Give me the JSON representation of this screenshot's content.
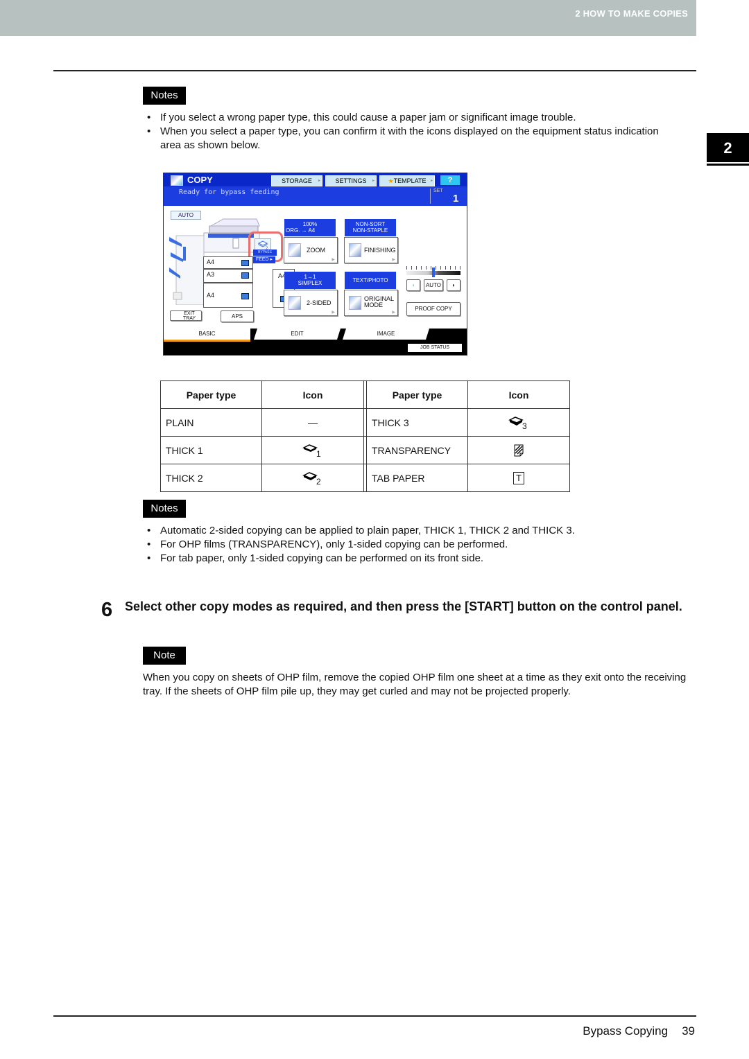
{
  "header": {
    "chapter_title": "2 HOW TO MAKE COPIES",
    "chapter_tab": "2"
  },
  "notes1": {
    "label": "Notes",
    "items": [
      "If you select a wrong paper type, this could cause a paper jam or significant image trouble.",
      "When you select a paper type, you can confirm it with the icons displayed on the equipment status indication area as shown below."
    ]
  },
  "panel": {
    "title": "COPY",
    "buttons": {
      "storage": "STORAGE",
      "settings": "SETTINGS",
      "template": "TEMPLATE",
      "help": "?"
    },
    "status_message": "Ready for bypass feeding",
    "set_label": "SET",
    "set_value": "1",
    "auto_label": "AUTO",
    "trays": [
      {
        "size": "A4"
      },
      {
        "size": "A3"
      },
      {
        "size": "A4"
      }
    ],
    "bypass_size": "A4",
    "bypass_label": "BYPASS",
    "feed_label": "FEED ▸",
    "exit_tray_label": "EXIT TRAY",
    "aps_label": "APS",
    "zoom_status": [
      "100%",
      "ORG. → A4"
    ],
    "zoom_label": "ZOOM",
    "finishing_status": [
      "NON-SORT",
      "NON-STAPLE"
    ],
    "finishing_label": "FINISHING",
    "duplex_status": [
      "1→1",
      "SIMPLEX"
    ],
    "duplex_label": "2-SIDED",
    "original_status": [
      "TEXT/PHOTO"
    ],
    "original_label": "ORIGINAL MODE",
    "density_level_fraction": 0.5,
    "density_auto_label": "AUTO",
    "proof_copy_label": "PROOF COPY",
    "tabs": [
      {
        "label": "BASIC",
        "active": true
      },
      {
        "label": "EDIT"
      },
      {
        "label": "IMAGE"
      }
    ],
    "job_status_label": "JOB STATUS",
    "colors": {
      "title_blue": "#0a28c8",
      "status_blue": "#1c3ee0",
      "tab_accent": "#f39a1a",
      "highlight": "#ea7070"
    }
  },
  "paper_table": {
    "headers": [
      "Paper type",
      "Icon",
      "Paper type",
      "Icon"
    ],
    "rows": [
      {
        "left_type": "PLAIN",
        "left_icon": "—",
        "right_type": "THICK 3",
        "right_icon": "thick-3-icon"
      },
      {
        "left_type": "THICK 1",
        "left_icon": "thick-1-icon",
        "right_type": "TRANSPARENCY",
        "right_icon": "transparency-icon"
      },
      {
        "left_type": "THICK 2",
        "left_icon": "thick-2-icon",
        "right_type": "TAB PAPER",
        "right_icon": "tab-paper-icon"
      }
    ],
    "icon_subscripts": {
      "thick1": "1",
      "thick2": "2",
      "thick3": "3",
      "tab": "T"
    }
  },
  "notes2": {
    "label": "Notes",
    "items": [
      "Automatic 2-sided copying can be applied to plain paper, THICK 1, THICK 2 and THICK 3.",
      "For OHP films (TRANSPARENCY), only 1-sided copying can be performed.",
      "For tab paper, only 1-sided copying can be performed on its front side."
    ]
  },
  "step6": {
    "number": "6",
    "text": "Select other copy modes as required, and then press the [START] button on the control panel."
  },
  "note3": {
    "label": "Note",
    "text": "When you copy on sheets of OHP film, remove the copied OHP film one sheet at a time as they exit onto the receiving tray. If the sheets of OHP film pile up, they may get curled and may not be projected properly."
  },
  "footer": {
    "section": "Bypass Copying",
    "page_number": "39"
  }
}
